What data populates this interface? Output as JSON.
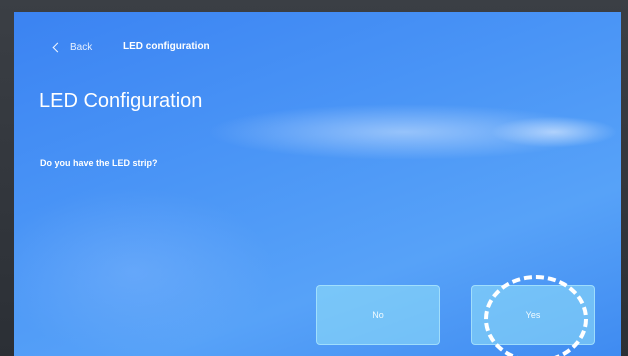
{
  "nav": {
    "back_label": "Back",
    "title": "LED configuration"
  },
  "main": {
    "heading": "LED Configuration",
    "question": "Do you have the LED strip?"
  },
  "actions": {
    "no_label": "No",
    "yes_label": "Yes"
  },
  "icons": {
    "back": "chevron-left-icon"
  },
  "colors": {
    "screen_bg": "#4a95f6",
    "button_bg": "#96e4fa",
    "text": "#ffffff"
  }
}
